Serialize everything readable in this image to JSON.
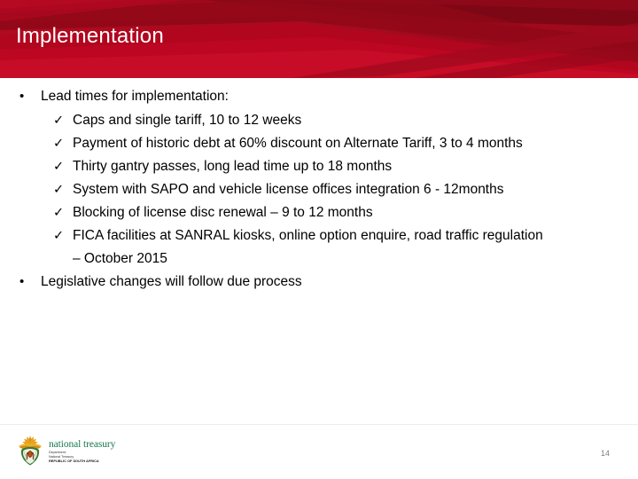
{
  "slide": {
    "title": "Implementation",
    "page_number": "14",
    "accent_color": "#b4061f",
    "title_color": "#ffffff",
    "body_text_color": "#000000"
  },
  "body": {
    "bullets": [
      {
        "level": 1,
        "marker": "•",
        "text": "Lead times for implementation:"
      },
      {
        "level": 2,
        "marker": "✓",
        "text": "Caps and single tariff, 10 to 12 weeks"
      },
      {
        "level": 2,
        "marker": "✓",
        "text": "Payment of historic debt at 60% discount on Alternate Tariff, 3 to 4 months"
      },
      {
        "level": 2,
        "marker": "✓",
        "text": "Thirty gantry passes, long lead time up to 18 months"
      },
      {
        "level": 2,
        "marker": "✓",
        "text": "System with SAPO and vehicle license offices integration 6 - 12months"
      },
      {
        "level": 2,
        "marker": "✓",
        "text": "Blocking of license disc renewal – 9 to 12 months"
      },
      {
        "level": 2,
        "marker": "✓",
        "text": "FICA facilities at SANRAL kiosks, online option enquire, road traffic regulation",
        "continuation": "– October 2015"
      },
      {
        "level": 1,
        "marker": "•",
        "text": "Legislative changes will follow due process"
      }
    ]
  },
  "footer": {
    "logo": {
      "emblem_name": "south-africa-coat-of-arms",
      "wordmark": "national treasury",
      "line1": "Department:",
      "line2": "National Treasury",
      "line3": "REPUBLIC OF SOUTH AFRICA",
      "wordmark_color": "#1a7a4c"
    }
  }
}
